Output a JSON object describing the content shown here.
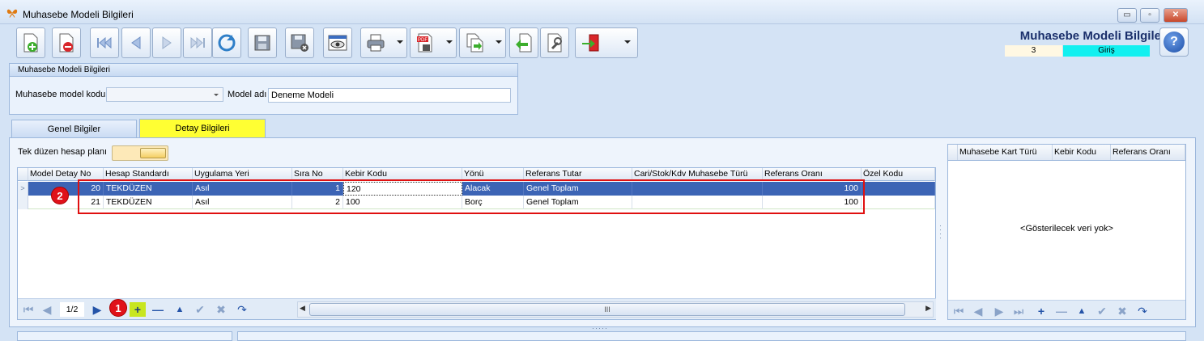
{
  "window": {
    "title": "Muhasebe Modeli Bilgileri",
    "minimize_glyph": "▭",
    "maximize_glyph": "▫",
    "close_glyph": "✕"
  },
  "toolbar": {
    "buttons": [
      "new-record-icon",
      "delete-record-icon",
      "first-record-icon",
      "previous-record-icon",
      "next-record-icon",
      "last-record-icon",
      "refresh-icon",
      "save-icon",
      "save-cancel-icon",
      "preview-icon",
      "print-icon",
      "pdf-export-icon",
      "transfer-icon",
      "back-icon",
      "tools-icon",
      "exit-icon"
    ]
  },
  "header": {
    "title": "Muhasebe Modeli Bilgileri",
    "record_number": "3",
    "mode": "Giriş",
    "help_glyph": "?"
  },
  "model_group": {
    "title": "Muhasebe Modeli Bilgileri",
    "kod_label": "Muhasebe model kodu",
    "kod_value": "",
    "adi_label": "Model adı",
    "adi_value": "Deneme Modeli"
  },
  "tabs": [
    {
      "label": "Genel Bilgiler",
      "active": false
    },
    {
      "label": "Detay Bilgileri",
      "active": true
    }
  ],
  "detail": {
    "tek_duzen_label": "Tek düzen hesap planı",
    "columns": [
      "Model Detay No",
      "Hesap Standardı",
      "Uygulama Yeri",
      "Sıra No",
      "Kebir Kodu",
      "Yönü",
      "Referans Tutar",
      "Cari/Stok/Kdv Muhasebe Türü",
      "Referans Oranı",
      "Özel Kodu"
    ],
    "rows": [
      {
        "detay_no": "20",
        "standart": "TEKDÜZEN",
        "yer": "Asıl",
        "sira": "1",
        "kebir": "120",
        "yonu": "Alacak",
        "tutar": "Genel Toplam",
        "tur": "",
        "oran": "100",
        "ozel": ""
      },
      {
        "detay_no": "21",
        "standart": "TEKDÜZEN",
        "yer": "Asıl",
        "sira": "2",
        "kebir": "100",
        "yonu": "Borç",
        "tutar": "Genel Toplam",
        "tur": "",
        "oran": "100",
        "ozel": ""
      }
    ],
    "pager": "1/2",
    "scroll_grip": "III",
    "row_indicator": ">"
  },
  "annotations": {
    "badge1": "1",
    "badge2": "2"
  },
  "right_grid": {
    "columns": [
      "Muhasebe Kart Türü",
      "Kebir Kodu",
      "Referans Oranı"
    ],
    "empty_message": "<Gösterilecek veri yok>"
  },
  "colors": {
    "selected_row": "#3c64b5",
    "highlight_tab": "#ffff33",
    "mode_bg": "#12f0f0",
    "annotation_red": "#e0121a"
  }
}
